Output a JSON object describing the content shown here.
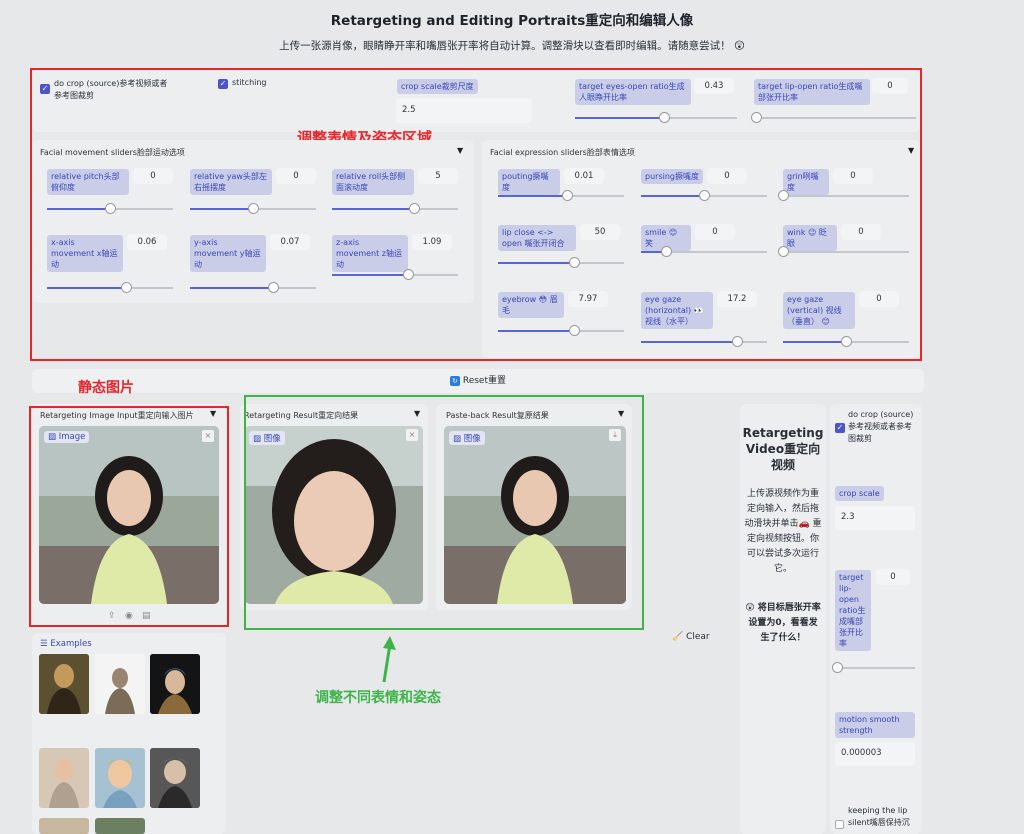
{
  "page": {
    "title": "Retargeting and Editing Portraits重定向和编辑人像",
    "subtitle": "上传一张源肖像，眼睛睁开率和嘴唇张开率将自动计算。调整滑块以查看即时编辑。请随意尝试！",
    "subtitle_emoji": "😲"
  },
  "top_controls": {
    "do_crop_label": "do crop (source)参考视频或者参考图裁剪",
    "stitching_label": "stitching",
    "crop_scale_label": "crop scale裁剪尺度",
    "crop_scale_value": "2.5",
    "eyes_label": "target eyes-open ratio生成人眼睁开比率",
    "eyes_value": "0.43",
    "eyes_level": 0.55,
    "lip_label": "target lip-open ratio生成嘴部张开比率",
    "lip_value": "0",
    "lip_level": 0.0
  },
  "annotations": {
    "expr_area": "调整表情及姿态区域",
    "static_image": "静态图片",
    "adjust": "调整不同表情和姿态"
  },
  "movement": {
    "header": "Facial movement sliders脸部运动选项",
    "sliders": [
      {
        "label": "relative pitch头部俯仰度",
        "value": "0",
        "level": 0.5
      },
      {
        "label": "relative yaw头部左右摇摆度",
        "value": "0",
        "level": 0.5
      },
      {
        "label": "relative roll头部侧面滚动度",
        "value": "5",
        "level": 0.65
      },
      {
        "label": "x-axis movement x轴运动",
        "value": "0.06",
        "level": 0.63
      },
      {
        "label": "y-axis movement y轴运动",
        "value": "0.07",
        "level": 0.66
      },
      {
        "label": "z-axis movement z轴运动",
        "value": "1.09",
        "level": 0.6
      }
    ]
  },
  "expression": {
    "header": "Facial expression sliders脸部表情选项",
    "sliders": [
      {
        "label": "pouting撅嘴度",
        "value": "0.01",
        "level": 0.55
      },
      {
        "label": "pursing撅嘴度",
        "value": "0",
        "level": 0.5
      },
      {
        "label": "grin咧嘴度",
        "value": "0",
        "level": 0.0
      },
      {
        "label": "lip close <-> open 嘴张开闭合",
        "value": "50",
        "level": 0.6
      },
      {
        "label": "smile 😊 笑",
        "value": "0",
        "level": 0.2
      },
      {
        "label": "wink 😉 眨眼",
        "value": "0",
        "level": 0.0
      },
      {
        "label": "eyebrow 😳 眉毛",
        "value": "7.97",
        "level": 0.6
      },
      {
        "label": "eye gaze (horizontal) 👀 视线（水平）",
        "value": "17.2",
        "level": 0.76
      },
      {
        "label": "eye gaze (vertical) 视线（垂直） 😊",
        "value": "0",
        "level": 0.5
      }
    ]
  },
  "reset_button": "Reset重置",
  "image_input": {
    "header": "Retargeting Image Input重定向输入图片",
    "tag": "Image"
  },
  "result": {
    "header": "Retargeting Result重定向结果",
    "tag": "图像"
  },
  "pasteback": {
    "header": "Paste-back Result复原结果",
    "tag": "图像"
  },
  "examples_label": "Examples",
  "video": {
    "title": "Retargeting Video重定向视频",
    "desc": "上传源视频作为重定向输入，然后拖动滑块并单击🚗 重定向视频按钮。你可以尝试多次运行它。",
    "desc2": "😲 将目标唇张开率设置为0，看看发生了什么！",
    "clear": "Clear",
    "do_crop_label": "do crop (source) 参考视频或者参考图裁剪",
    "crop_scale_label": "crop scale",
    "crop_scale_value": "2.3",
    "target_lip_label": "target lip-open ratio生成嘴部张开比率",
    "target_lip_value": "0",
    "motion_label": "motion smooth strength",
    "motion_value": "0.000003",
    "keep_lip_label": "keeping the lip silent嘴唇保持沉"
  }
}
